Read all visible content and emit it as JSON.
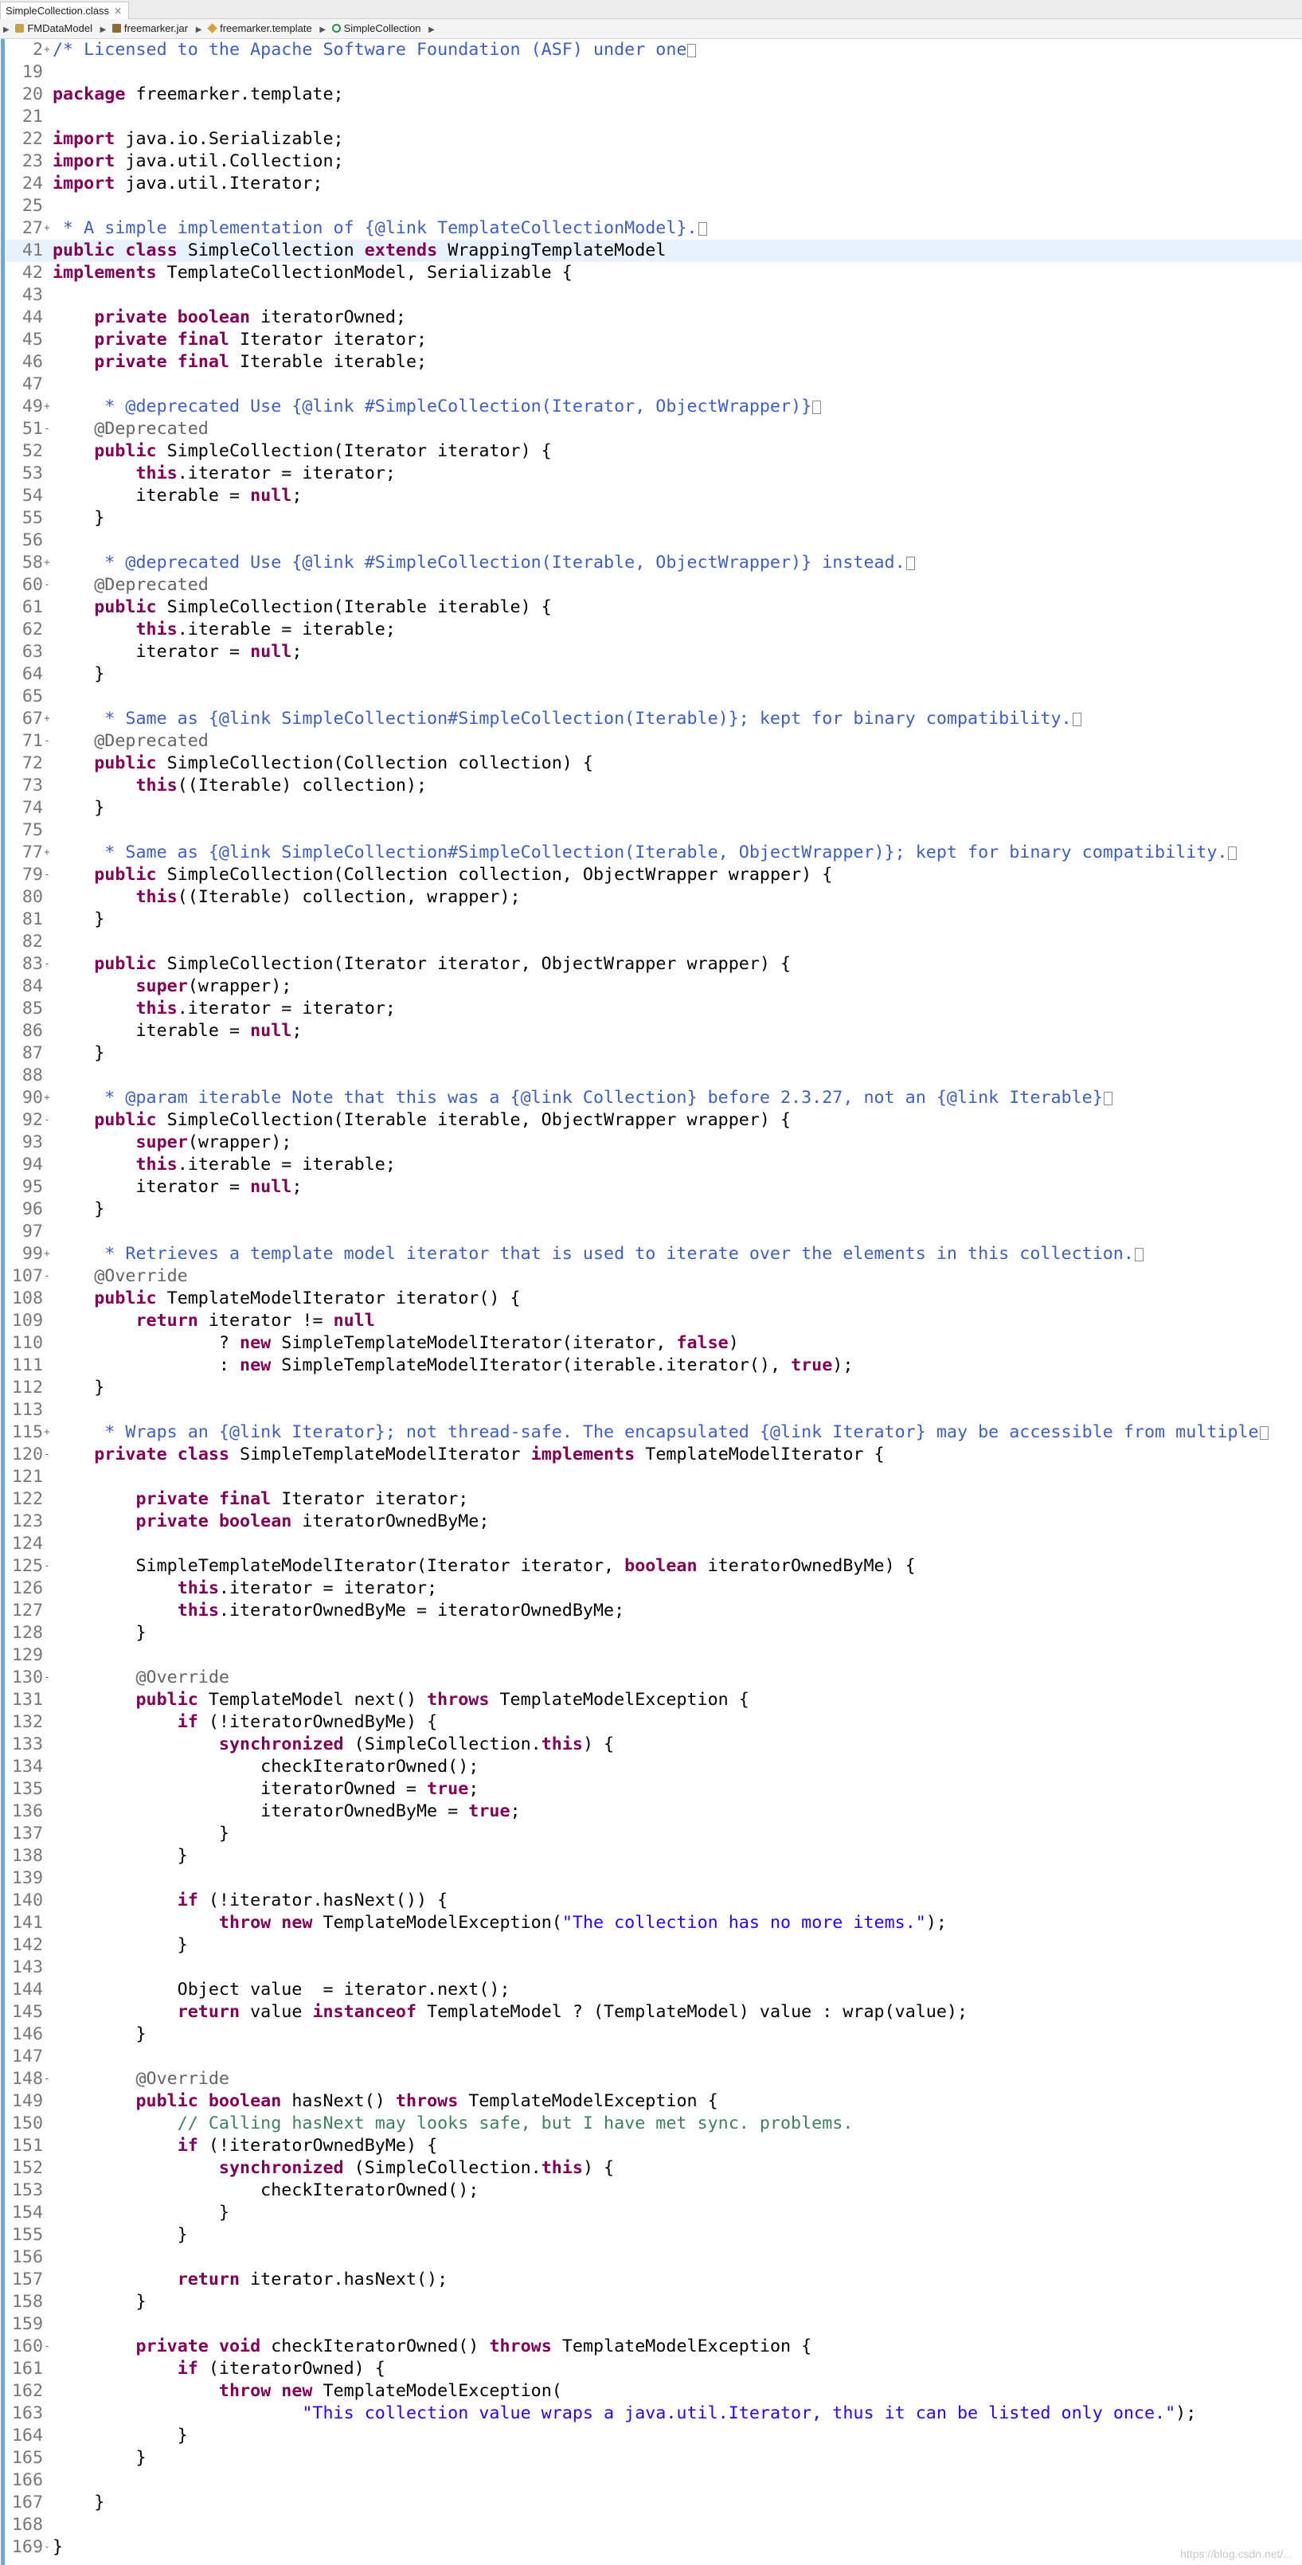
{
  "editor_tab": {
    "title": "SimpleCollection.class",
    "close": "✕"
  },
  "breadcrumb": [
    "FMDataModel",
    "freemarker.jar",
    "freemarker.template",
    "SimpleCollection"
  ],
  "watermark": "https://blog.csdn.net/...",
  "colors": {
    "keyword": "#7f0055",
    "field": "#0000c0",
    "local": "#6a3e3e",
    "string": "#2a00ff",
    "javadoc": "#3f5fbf",
    "annotation": "#646464",
    "ruler": "#6aa6d6"
  },
  "lines": [
    {
      "n": "2",
      "f": "+",
      "code": "/* Licensed to the Apache Software Foundation (ASF) under one"
    },
    {
      "n": "19",
      "f": "",
      "code": ""
    },
    {
      "n": "20",
      "f": "",
      "code": "package freemarker.template;"
    },
    {
      "n": "21",
      "f": "",
      "code": ""
    },
    {
      "n": "22",
      "f": "",
      "code": "import java.io.Serializable;"
    },
    {
      "n": "23",
      "f": "",
      "code": "import java.util.Collection;"
    },
    {
      "n": "24",
      "f": "",
      "code": "import java.util.Iterator;"
    },
    {
      "n": "25",
      "f": "",
      "code": ""
    },
    {
      "n": "27",
      "f": "+",
      "code": " * A simple implementation of {@link TemplateCollectionModel}."
    },
    {
      "n": "41",
      "f": "",
      "code": "public class SimpleCollection extends WrappingTemplateModel"
    },
    {
      "n": "42",
      "f": "",
      "code": "implements TemplateCollectionModel, Serializable {"
    },
    {
      "n": "43",
      "f": "",
      "code": ""
    },
    {
      "n": "44",
      "f": "",
      "code": "    private boolean iteratorOwned;"
    },
    {
      "n": "45",
      "f": "",
      "code": "    private final Iterator iterator;"
    },
    {
      "n": "46",
      "f": "",
      "code": "    private final Iterable iterable;"
    },
    {
      "n": "47",
      "f": "",
      "code": ""
    },
    {
      "n": "49",
      "f": "+",
      "code": "     * @deprecated Use {@link #SimpleCollection(Iterator, ObjectWrapper)}"
    },
    {
      "n": "51",
      "f": "-",
      "code": "    @Deprecated"
    },
    {
      "n": "52",
      "f": "",
      "code": "    public SimpleCollection(Iterator iterator) {"
    },
    {
      "n": "53",
      "f": "",
      "code": "        this.iterator = iterator;"
    },
    {
      "n": "54",
      "f": "",
      "code": "        iterable = null;"
    },
    {
      "n": "55",
      "f": "",
      "code": "    }"
    },
    {
      "n": "56",
      "f": "",
      "code": ""
    },
    {
      "n": "58",
      "f": "+",
      "code": "     * @deprecated Use {@link #SimpleCollection(Iterable, ObjectWrapper)} instead."
    },
    {
      "n": "60",
      "f": "-",
      "code": "    @Deprecated"
    },
    {
      "n": "61",
      "f": "",
      "code": "    public SimpleCollection(Iterable iterable) {"
    },
    {
      "n": "62",
      "f": "",
      "code": "        this.iterable = iterable;"
    },
    {
      "n": "63",
      "f": "",
      "code": "        iterator = null;"
    },
    {
      "n": "64",
      "f": "",
      "code": "    }"
    },
    {
      "n": "65",
      "f": "",
      "code": ""
    },
    {
      "n": "67",
      "f": "+",
      "code": "     * Same as {@link SimpleCollection#SimpleCollection(Iterable)}; kept for binary compatibility."
    },
    {
      "n": "71",
      "f": "-",
      "code": "    @Deprecated"
    },
    {
      "n": "72",
      "f": "",
      "code": "    public SimpleCollection(Collection collection) {"
    },
    {
      "n": "73",
      "f": "",
      "code": "        this((Iterable) collection);"
    },
    {
      "n": "74",
      "f": "",
      "code": "    }"
    },
    {
      "n": "75",
      "f": "",
      "code": ""
    },
    {
      "n": "77",
      "f": "+",
      "code": "     * Same as {@link SimpleCollection#SimpleCollection(Iterable, ObjectWrapper)}; kept for binary compatibility."
    },
    {
      "n": "79",
      "f": "-",
      "code": "    public SimpleCollection(Collection collection, ObjectWrapper wrapper) {"
    },
    {
      "n": "80",
      "f": "",
      "code": "        this((Iterable) collection, wrapper);"
    },
    {
      "n": "81",
      "f": "",
      "code": "    }"
    },
    {
      "n": "82",
      "f": "",
      "code": ""
    },
    {
      "n": "83",
      "f": "-",
      "code": "    public SimpleCollection(Iterator iterator, ObjectWrapper wrapper) {"
    },
    {
      "n": "84",
      "f": "",
      "code": "        super(wrapper);"
    },
    {
      "n": "85",
      "f": "",
      "code": "        this.iterator = iterator;"
    },
    {
      "n": "86",
      "f": "",
      "code": "        iterable = null;"
    },
    {
      "n": "87",
      "f": "",
      "code": "    }"
    },
    {
      "n": "88",
      "f": "",
      "code": ""
    },
    {
      "n": "90",
      "f": "+",
      "code": "     * @param iterable Note that this was a {@link Collection} before 2.3.27, not an {@link Iterable}"
    },
    {
      "n": "92",
      "f": "-",
      "code": "    public SimpleCollection(Iterable iterable, ObjectWrapper wrapper) {"
    },
    {
      "n": "93",
      "f": "",
      "code": "        super(wrapper);"
    },
    {
      "n": "94",
      "f": "",
      "code": "        this.iterable = iterable;"
    },
    {
      "n": "95",
      "f": "",
      "code": "        iterator = null;"
    },
    {
      "n": "96",
      "f": "",
      "code": "    }"
    },
    {
      "n": "97",
      "f": "",
      "code": ""
    },
    {
      "n": "99",
      "f": "+",
      "code": "     * Retrieves a template model iterator that is used to iterate over the elements in this collection."
    },
    {
      "n": "107",
      "f": "-",
      "code": "    @Override"
    },
    {
      "n": "108",
      "f": "",
      "code": "    public TemplateModelIterator iterator() {"
    },
    {
      "n": "109",
      "f": "",
      "code": "        return iterator != null"
    },
    {
      "n": "110",
      "f": "",
      "code": "                ? new SimpleTemplateModelIterator(iterator, false)"
    },
    {
      "n": "111",
      "f": "",
      "code": "                : new SimpleTemplateModelIterator(iterable.iterator(), true);"
    },
    {
      "n": "112",
      "f": "",
      "code": "    }"
    },
    {
      "n": "113",
      "f": "",
      "code": ""
    },
    {
      "n": "115",
      "f": "+",
      "code": "     * Wraps an {@link Iterator}; not thread-safe. The encapsulated {@link Iterator} may be accessible from multiple"
    },
    {
      "n": "120",
      "f": "-",
      "code": "    private class SimpleTemplateModelIterator implements TemplateModelIterator {"
    },
    {
      "n": "121",
      "f": "",
      "code": ""
    },
    {
      "n": "122",
      "f": "",
      "code": "        private final Iterator iterator;"
    },
    {
      "n": "123",
      "f": "",
      "code": "        private boolean iteratorOwnedByMe;"
    },
    {
      "n": "124",
      "f": "",
      "code": ""
    },
    {
      "n": "125",
      "f": "-",
      "code": "        SimpleTemplateModelIterator(Iterator iterator, boolean iteratorOwnedByMe) {"
    },
    {
      "n": "126",
      "f": "",
      "code": "            this.iterator = iterator;"
    },
    {
      "n": "127",
      "f": "",
      "code": "            this.iteratorOwnedByMe = iteratorOwnedByMe;"
    },
    {
      "n": "128",
      "f": "",
      "code": "        }"
    },
    {
      "n": "129",
      "f": "",
      "code": ""
    },
    {
      "n": "130",
      "f": "-",
      "code": "        @Override"
    },
    {
      "n": "131",
      "f": "",
      "code": "        public TemplateModel next() throws TemplateModelException {"
    },
    {
      "n": "132",
      "f": "",
      "code": "            if (!iteratorOwnedByMe) {"
    },
    {
      "n": "133",
      "f": "",
      "code": "                synchronized (SimpleCollection.this) {"
    },
    {
      "n": "134",
      "f": "",
      "code": "                    checkIteratorOwned();"
    },
    {
      "n": "135",
      "f": "",
      "code": "                    iteratorOwned = true;"
    },
    {
      "n": "136",
      "f": "",
      "code": "                    iteratorOwnedByMe = true;"
    },
    {
      "n": "137",
      "f": "",
      "code": "                }"
    },
    {
      "n": "138",
      "f": "",
      "code": "            }"
    },
    {
      "n": "139",
      "f": "",
      "code": ""
    },
    {
      "n": "140",
      "f": "",
      "code": "            if (!iterator.hasNext()) {"
    },
    {
      "n": "141",
      "f": "",
      "code": "                throw new TemplateModelException(\"The collection has no more items.\");"
    },
    {
      "n": "142",
      "f": "",
      "code": "            }"
    },
    {
      "n": "143",
      "f": "",
      "code": ""
    },
    {
      "n": "144",
      "f": "",
      "code": "            Object value  = iterator.next();"
    },
    {
      "n": "145",
      "f": "",
      "code": "            return value instanceof TemplateModel ? (TemplateModel) value : wrap(value);"
    },
    {
      "n": "146",
      "f": "",
      "code": "        }"
    },
    {
      "n": "147",
      "f": "",
      "code": ""
    },
    {
      "n": "148",
      "f": "-",
      "code": "        @Override"
    },
    {
      "n": "149",
      "f": "",
      "code": "        public boolean hasNext() throws TemplateModelException {"
    },
    {
      "n": "150",
      "f": "",
      "code": "            // Calling hasNext may looks safe, but I have met sync. problems."
    },
    {
      "n": "151",
      "f": "",
      "code": "            if (!iteratorOwnedByMe) {"
    },
    {
      "n": "152",
      "f": "",
      "code": "                synchronized (SimpleCollection.this) {"
    },
    {
      "n": "153",
      "f": "",
      "code": "                    checkIteratorOwned();"
    },
    {
      "n": "154",
      "f": "",
      "code": "                }"
    },
    {
      "n": "155",
      "f": "",
      "code": "            }"
    },
    {
      "n": "156",
      "f": "",
      "code": ""
    },
    {
      "n": "157",
      "f": "",
      "code": "            return iterator.hasNext();"
    },
    {
      "n": "158",
      "f": "",
      "code": "        }"
    },
    {
      "n": "159",
      "f": "",
      "code": ""
    },
    {
      "n": "160",
      "f": "-",
      "code": "        private void checkIteratorOwned() throws TemplateModelException {"
    },
    {
      "n": "161",
      "f": "",
      "code": "            if (iteratorOwned) {"
    },
    {
      "n": "162",
      "f": "",
      "code": "                throw new TemplateModelException("
    },
    {
      "n": "163",
      "f": "",
      "code": "                        \"This collection value wraps a java.util.Iterator, thus it can be listed only once.\");"
    },
    {
      "n": "164",
      "f": "",
      "code": "            }"
    },
    {
      "n": "165",
      "f": "",
      "code": "        }"
    },
    {
      "n": "166",
      "f": "",
      "code": ""
    },
    {
      "n": "167",
      "f": "",
      "code": "    }"
    },
    {
      "n": "168",
      "f": "",
      "code": ""
    },
    {
      "n": "169",
      "f": "-",
      "code": "}"
    }
  ]
}
